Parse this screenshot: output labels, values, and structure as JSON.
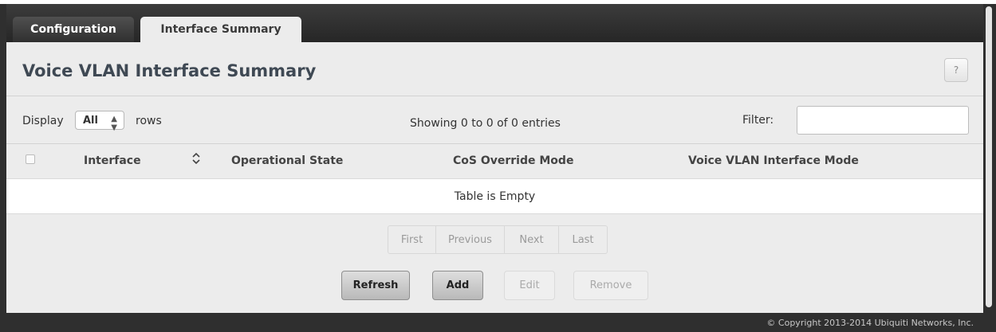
{
  "tabs": [
    {
      "label": "Configuration",
      "active": false
    },
    {
      "label": "Interface Summary",
      "active": true
    }
  ],
  "page": {
    "title": "Voice VLAN Interface Summary",
    "help_label": "?"
  },
  "controls": {
    "display_label": "Display",
    "rows_value": "All",
    "rows_label": "rows",
    "showing_text": "Showing 0 to 0 of 0 entries",
    "filter_label": "Filter:",
    "filter_value": ""
  },
  "table": {
    "columns": [
      "Interface",
      "Operational State",
      "CoS Override Mode",
      "Voice VLAN Interface Mode"
    ],
    "empty_message": "Table is Empty"
  },
  "pager": {
    "buttons": [
      "First",
      "Previous",
      "Next",
      "Last"
    ]
  },
  "actions": {
    "refresh": "Refresh",
    "add": "Add",
    "edit": "Edit",
    "remove": "Remove"
  },
  "footer": {
    "copyright": "© Copyright 2013-2014 Ubiquiti Networks, Inc."
  },
  "icons": {
    "sort": "sort-updown-icon",
    "select_arrows": "select-updown-icon",
    "help": "help-icon"
  },
  "colors": {
    "tab_bar": "#2f2f2f",
    "panel": "#ececec",
    "title_text": "#3f4954"
  }
}
